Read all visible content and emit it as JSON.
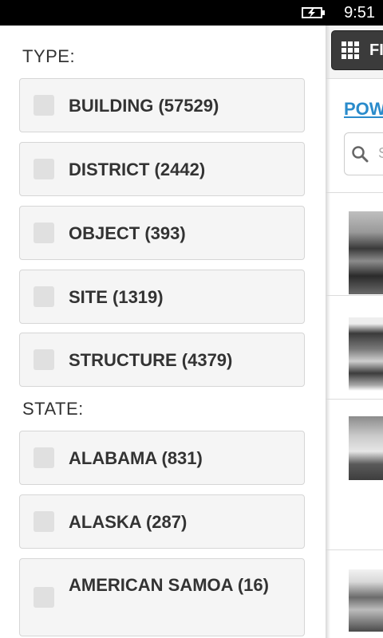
{
  "status_bar": {
    "time": "9:51",
    "battery_icon": "battery-charging-icon"
  },
  "filters": {
    "type": {
      "label": "TYPE:",
      "items": [
        {
          "label": "BUILDING (57529)",
          "checked": false
        },
        {
          "label": "DISTRICT (2442)",
          "checked": false
        },
        {
          "label": "OBJECT (393)",
          "checked": false
        },
        {
          "label": "SITE (1319)",
          "checked": false
        },
        {
          "label": "STRUCTURE (4379)",
          "checked": false
        }
      ]
    },
    "state": {
      "label": "STATE:",
      "items": [
        {
          "label": "ALABAMA (831)",
          "checked": false
        },
        {
          "label": "ALASKA (287)",
          "checked": false
        },
        {
          "label": "AMERICAN SAMOA (16)",
          "checked": false
        }
      ]
    }
  },
  "content": {
    "filter_button_label": "FI",
    "powered_link": "POW",
    "search_placeholder": "S",
    "icons": {
      "filter": "grid-icon",
      "search": "search-icon"
    }
  },
  "colors": {
    "link": "#2a8bcb",
    "item_bg": "#f5f5f5",
    "item_border": "#d6d6d6",
    "checkbox": "#e0e0e0",
    "button_bg": "#3b3b3b"
  }
}
